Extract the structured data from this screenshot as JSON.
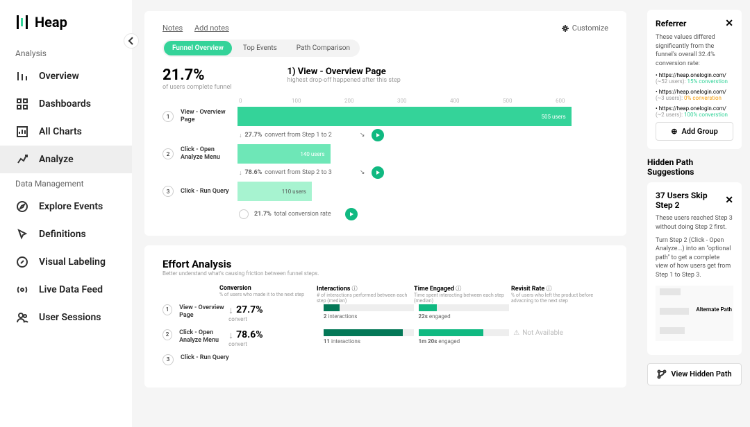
{
  "brand": "Heap",
  "sidebar": {
    "section1": "Analysis",
    "section2": "Data Management",
    "items": [
      "Overview",
      "Dashboards",
      "All Charts",
      "Analyze",
      "Explore Events",
      "Definitions",
      "Visual Labeling",
      "Live Data Feed",
      "User Sessions"
    ]
  },
  "topbar": {
    "notes": "Notes",
    "add_notes": "Add notes",
    "customize": "Customize"
  },
  "tabs": [
    "Funnel Overview",
    "Top Events",
    "Path Comparison"
  ],
  "summary": {
    "pct": "21.7%",
    "pct_sub": "of users complete funnel",
    "step_title": "1) View - Overview Page",
    "step_sub": "highest drop-off happened after this step"
  },
  "axis": [
    "0",
    "100",
    "200",
    "300",
    "400",
    "500",
    "600"
  ],
  "steps": [
    {
      "n": "1",
      "label": "View - Overview Page",
      "users": "505 users"
    },
    {
      "n": "2",
      "label": "Click - Open Analyze Menu",
      "users": "140 users"
    },
    {
      "n": "3",
      "label": "Click - Run Query",
      "users": "110 users"
    }
  ],
  "between": [
    {
      "pct": "27.7%",
      "text": "convert from Step 1 to 2"
    },
    {
      "pct": "78.6%",
      "text": "convert from Step 2 to 3"
    }
  ],
  "total": {
    "pct": "21.7%",
    "text": "total conversion rate"
  },
  "effort": {
    "title": "Effort Analysis",
    "sub": "Better understand what's causing friction between funnel steps.",
    "cols": [
      {
        "h": "Conversion",
        "d": "% of users who made it to the next step"
      },
      {
        "h": "Interactions",
        "d": "# of interactions performed between each step (median)"
      },
      {
        "h": "Time Engaged",
        "d": "Time spent interacting between each step (median)"
      },
      {
        "h": "Revisit Rate",
        "d": "% of users who left the product before advacning to the next step"
      }
    ],
    "rows": [
      {
        "n": "1",
        "label": "View - Overview Page",
        "conv": "27.7%",
        "convsub": "convert",
        "inter": "2",
        "intertxt": "interactions",
        "time": "22s",
        "timetxt": "engaged",
        "revisit": ""
      },
      {
        "n": "2",
        "label": "Click - Open Analyze Menu",
        "conv": "78.6%",
        "convsub": "convert",
        "inter": "11",
        "intertxt": "interactions",
        "time": "1m 20s",
        "timetxt": "engaged",
        "revisit": "Not Available"
      },
      {
        "n": "3",
        "label": "Click - Run Query"
      }
    ]
  },
  "referrer": {
    "title": "Referrer",
    "text": "These values differed significantly from the funnel's overall 32.4% conversion rate:",
    "items": [
      {
        "url": "https://heap.onelogin.com/",
        "sub": "(~52 users):",
        "val": "15% converstion",
        "cls": "g"
      },
      {
        "url": "https://heap.onelogin.com/",
        "sub": "(~3 users):",
        "val": "0% converstion",
        "cls": "o"
      },
      {
        "url": "https://heap.onelogin.com/",
        "sub": "(~2 users):",
        "val": "100% converstion",
        "cls": "g"
      }
    ],
    "add": "Add Group"
  },
  "hidden": {
    "heading": "Hidden Path Suggestions",
    "title": "37 Users Skip Step 2",
    "p1": "These users reached Step 3 without doing Step 2 first.",
    "p2": "Turn Step 2 (Click - Open Analyze...) into an \"optional path\" to get a complete view of how users get from Step 1 to Step 3.",
    "alt": "Alternate Path",
    "btn": "View Hidden Path"
  },
  "chart_data": {
    "type": "bar",
    "title": "Funnel Overview",
    "xlabel": "users",
    "ylabel": "",
    "categories": [
      "View - Overview Page",
      "Click - Open Analyze Menu",
      "Click - Run Query"
    ],
    "values": [
      505,
      140,
      110
    ],
    "xlim": [
      0,
      600
    ],
    "conversion_between_steps": [
      27.7,
      78.6
    ],
    "total_conversion": 21.7
  }
}
